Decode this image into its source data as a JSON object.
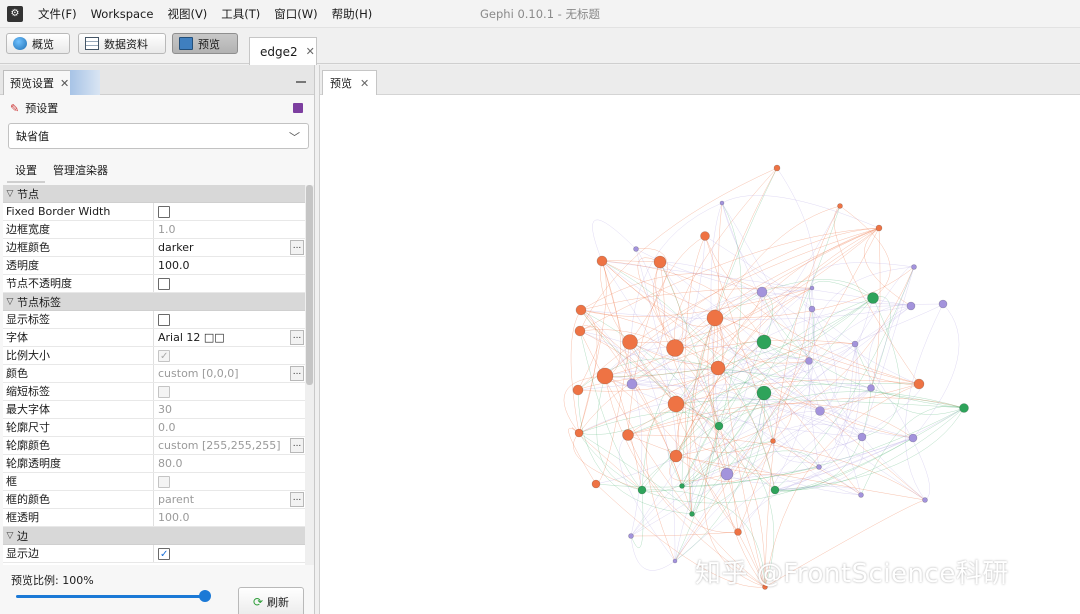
{
  "app": {
    "title": "Gephi 0.10.1 - 无标题",
    "icon_glyph": "⚙"
  },
  "menu": [
    "文件(F)",
    "Workspace",
    "视图(V)",
    "工具(T)",
    "窗口(W)",
    "帮助(H)"
  ],
  "toolbar": {
    "overview": "概览",
    "data_lab": "数据资料",
    "preview": "预览",
    "document_tab": "edge2",
    "close": "✕"
  },
  "left_panel": {
    "tab": "预览设置",
    "close": "✕",
    "preset_label": "预设置",
    "preset_value": "缺省值",
    "subtabs": [
      "设置",
      "管理渲染器"
    ],
    "ellipsis": "...",
    "categories": {
      "node": "节点",
      "node_label": "节点标签",
      "edge": "边"
    },
    "node_rows": [
      {
        "name": "Fixed Border Width",
        "type": "checkbox",
        "checked": false,
        "disabled": false
      },
      {
        "name": "边框宽度",
        "type": "text",
        "value": "1.0",
        "disabled": true
      },
      {
        "name": "边框颜色",
        "type": "text",
        "value": "darker",
        "disabled": false,
        "ellipsis": true
      },
      {
        "name": "透明度",
        "type": "text",
        "value": "100.0",
        "disabled": false
      },
      {
        "name": "节点不透明度",
        "type": "checkbox",
        "checked": false,
        "disabled": false
      }
    ],
    "label_rows": [
      {
        "name": "显示标签",
        "type": "checkbox",
        "checked": false,
        "disabled": false
      },
      {
        "name": "字体",
        "type": "text",
        "value": "Arial 12 □□",
        "disabled": false,
        "ellipsis": true
      },
      {
        "name": "比例大小",
        "type": "checkbox",
        "checked": true,
        "disabled": true
      },
      {
        "name": "颜色",
        "type": "text",
        "value": "custom [0,0,0]",
        "disabled": true,
        "ellipsis": true
      },
      {
        "name": "缩短标签",
        "type": "checkbox",
        "checked": false,
        "disabled": true
      },
      {
        "name": "最大字体",
        "type": "text",
        "value": "30",
        "disabled": true
      },
      {
        "name": "轮廓尺寸",
        "type": "text",
        "value": "0.0",
        "disabled": true
      },
      {
        "name": "轮廓颜色",
        "type": "text",
        "value": "custom [255,255,255]",
        "disabled": true,
        "ellipsis": true
      },
      {
        "name": "轮廓透明度",
        "type": "text",
        "value": "80.0",
        "disabled": true
      },
      {
        "name": "框",
        "type": "checkbox",
        "checked": false,
        "disabled": true
      },
      {
        "name": "框的颜色",
        "type": "text",
        "value": "parent",
        "disabled": true,
        "ellipsis": true
      },
      {
        "name": "框透明",
        "type": "text",
        "value": "100.0",
        "disabled": true
      }
    ],
    "edge_rows": [
      {
        "name": "显示边",
        "type": "checkbox",
        "checked": true,
        "disabled": false
      }
    ],
    "zoom_label": "预览比例:  100%",
    "zoom_level": 1.0,
    "refresh": "刷新"
  },
  "right_panel": {
    "tab": "预览",
    "close": "✕"
  },
  "watermark": "知乎 @FrontScience科研",
  "colors": {
    "orange": "#ee7344",
    "purple": "#a393dc",
    "green": "#2ea35a"
  }
}
